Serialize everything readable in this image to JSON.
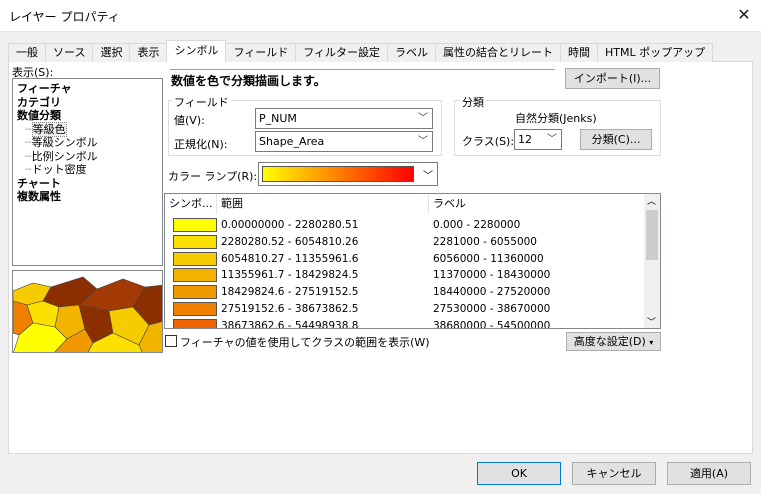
{
  "window": {
    "title": "レイヤー プロパティ"
  },
  "tabs": [
    {
      "label": "一般"
    },
    {
      "label": "ソース"
    },
    {
      "label": "選択"
    },
    {
      "label": "表示"
    },
    {
      "label": "シンボル",
      "active": true
    },
    {
      "label": "フィールド"
    },
    {
      "label": "フィルター設定"
    },
    {
      "label": "ラベル"
    },
    {
      "label": "属性の結合とリレート"
    },
    {
      "label": "時間"
    },
    {
      "label": "HTML ポップアップ"
    }
  ],
  "show": {
    "label": "表示(S):",
    "tree": [
      {
        "label": "フィーチャ",
        "bold": true,
        "indent": 0
      },
      {
        "label": "カテゴリ",
        "bold": true,
        "indent": 0
      },
      {
        "label": "数値分類",
        "bold": true,
        "indent": 0
      },
      {
        "label": "等級色",
        "indent": 1,
        "selected": true
      },
      {
        "label": "等級シンボル",
        "indent": 1
      },
      {
        "label": "比例シンボル",
        "indent": 1
      },
      {
        "label": "ドット密度",
        "indent": 1
      },
      {
        "label": "チャート",
        "bold": true,
        "indent": 0
      },
      {
        "label": "複数属性",
        "bold": true,
        "indent": 0
      }
    ]
  },
  "heading": "数値を色で分類描画します。",
  "import_label": "インポート(I)...",
  "fields": {
    "title": "フィールド",
    "value_label": "値(V):",
    "value": "P_NUM",
    "normalize_label": "正規化(N):",
    "normalize": "Shape_Area"
  },
  "classification": {
    "title": "分類",
    "method": "自然分類(Jenks)",
    "classes_label": "クラス(S):",
    "classes": "12",
    "classify_button": "分類(C)..."
  },
  "ramp_label": "カラー ランプ(R):",
  "colors": {
    "ramp_start": "#ffff00",
    "ramp_end": "#ff0000",
    "accent": "#0078d7"
  },
  "table": {
    "headers": [
      "シンボ...",
      "範囲",
      "ラベル"
    ],
    "rows": [
      {
        "color": "#ffff00",
        "range": "0.00000000 - 2280280.51",
        "label": "0.000 - 2280000"
      },
      {
        "color": "#fbe000",
        "range": "2280280.52 - 6054810.26",
        "label": "2281000 - 6055000"
      },
      {
        "color": "#f6cb00",
        "range": "6054810.27 - 11355961.6",
        "label": "6056000 - 11360000"
      },
      {
        "color": "#f3b400",
        "range": "11355961.7 - 18429824.5",
        "label": "11370000 - 18430000"
      },
      {
        "color": "#f19900",
        "range": "18429824.6 - 27519152.5",
        "label": "18440000 - 27520000"
      },
      {
        "color": "#ef8000",
        "range": "27519152.6 - 38673862.5",
        "label": "27530000 - 38670000"
      },
      {
        "color": "#ed6400",
        "range": "38673862.6 - 54498938.8",
        "label": "38680000 - 54500000"
      }
    ]
  },
  "checkbox_label": "フィーチャの値を使用してクラスの範囲を表示(W)",
  "advanced_label": "高度な設定(D)",
  "buttons": {
    "ok": "OK",
    "cancel": "キャンセル",
    "apply": "適用(A)"
  }
}
